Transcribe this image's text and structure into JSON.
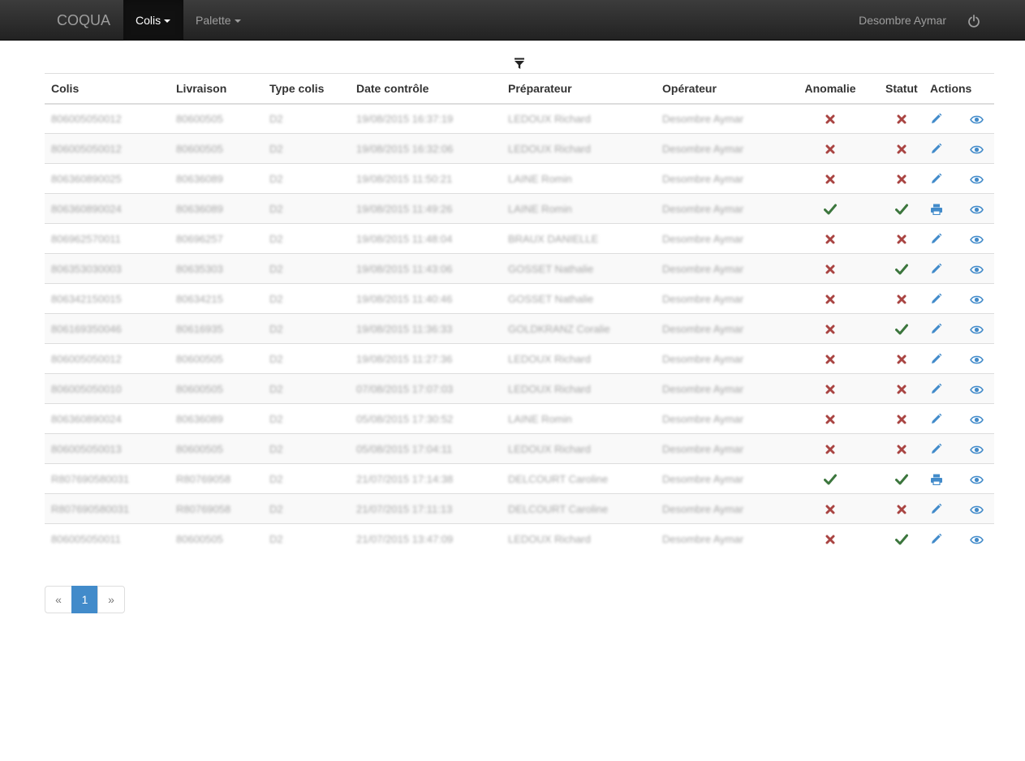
{
  "navbar": {
    "brand": "COQUA",
    "menu_colis": "Colis",
    "menu_palette": "Palette",
    "user": "Desombre Aymar",
    "power_icon": "power-icon"
  },
  "filter_icon": "filter-icon",
  "table": {
    "headers": [
      "Colis",
      "Livraison",
      "Type colis",
      "Date contrôle",
      "Préparateur",
      "Opérateur",
      "Anomalie",
      "Statut",
      "Actions"
    ],
    "rows": [
      {
        "colis": "806005050012",
        "livraison": "80600505",
        "type": "D2",
        "date": "19/08/2015 16:37:19",
        "preparateur": "LEDOUX Richard",
        "operateur": "Desombre Aymar",
        "anomalie": false,
        "statut": false,
        "action": "edit"
      },
      {
        "colis": "806005050012",
        "livraison": "80600505",
        "type": "D2",
        "date": "19/08/2015 16:32:06",
        "preparateur": "LEDOUX Richard",
        "operateur": "Desombre Aymar",
        "anomalie": false,
        "statut": false,
        "action": "edit"
      },
      {
        "colis": "806360890025",
        "livraison": "80636089",
        "type": "D2",
        "date": "19/08/2015 11:50:21",
        "preparateur": "LAINE Romin",
        "operateur": "Desombre Aymar",
        "anomalie": false,
        "statut": false,
        "action": "edit"
      },
      {
        "colis": "806360890024",
        "livraison": "80636089",
        "type": "D2",
        "date": "19/08/2015 11:49:26",
        "preparateur": "LAINE Romin",
        "operateur": "Desombre Aymar",
        "anomalie": true,
        "statut": true,
        "action": "print"
      },
      {
        "colis": "806962570011",
        "livraison": "80696257",
        "type": "D2",
        "date": "19/08/2015 11:48:04",
        "preparateur": "BRAUX DANIELLE",
        "operateur": "Desombre Aymar",
        "anomalie": false,
        "statut": false,
        "action": "edit"
      },
      {
        "colis": "806353030003",
        "livraison": "80635303",
        "type": "D2",
        "date": "19/08/2015 11:43:06",
        "preparateur": "GOSSET Nathalie",
        "operateur": "Desombre Aymar",
        "anomalie": false,
        "statut": true,
        "action": "edit"
      },
      {
        "colis": "806342150015",
        "livraison": "80634215",
        "type": "D2",
        "date": "19/08/2015 11:40:46",
        "preparateur": "GOSSET Nathalie",
        "operateur": "Desombre Aymar",
        "anomalie": false,
        "statut": false,
        "action": "edit"
      },
      {
        "colis": "806169350046",
        "livraison": "80616935",
        "type": "D2",
        "date": "19/08/2015 11:36:33",
        "preparateur": "GOLDKRANZ Coralie",
        "operateur": "Desombre Aymar",
        "anomalie": false,
        "statut": true,
        "action": "edit"
      },
      {
        "colis": "806005050012",
        "livraison": "80600505",
        "type": "D2",
        "date": "19/08/2015 11:27:36",
        "preparateur": "LEDOUX Richard",
        "operateur": "Desombre Aymar",
        "anomalie": false,
        "statut": false,
        "action": "edit"
      },
      {
        "colis": "806005050010",
        "livraison": "80600505",
        "type": "D2",
        "date": "07/08/2015 17:07:03",
        "preparateur": "LEDOUX Richard",
        "operateur": "Desombre Aymar",
        "anomalie": false,
        "statut": false,
        "action": "edit"
      },
      {
        "colis": "806360890024",
        "livraison": "80636089",
        "type": "D2",
        "date": "05/08/2015 17:30:52",
        "preparateur": "LAINE Romin",
        "operateur": "Desombre Aymar",
        "anomalie": false,
        "statut": false,
        "action": "edit"
      },
      {
        "colis": "806005050013",
        "livraison": "80600505",
        "type": "D2",
        "date": "05/08/2015 17:04:11",
        "preparateur": "LEDOUX Richard",
        "operateur": "Desombre Aymar",
        "anomalie": false,
        "statut": false,
        "action": "edit"
      },
      {
        "colis": "R807690580031",
        "livraison": "R80769058",
        "type": "D2",
        "date": "21/07/2015 17:14:38",
        "preparateur": "DELCOURT Caroline",
        "operateur": "Desombre Aymar",
        "anomalie": true,
        "statut": true,
        "action": "print"
      },
      {
        "colis": "R807690580031",
        "livraison": "R80769058",
        "type": "D2",
        "date": "21/07/2015 17:11:13",
        "preparateur": "DELCOURT Caroline",
        "operateur": "Desombre Aymar",
        "anomalie": false,
        "statut": false,
        "action": "edit"
      },
      {
        "colis": "806005050011",
        "livraison": "80600505",
        "type": "D2",
        "date": "21/07/2015 13:47:09",
        "preparateur": "LEDOUX Richard",
        "operateur": "Desombre Aymar",
        "anomalie": false,
        "statut": true,
        "action": "edit"
      }
    ]
  },
  "pagination": {
    "prev": "«",
    "current": "1",
    "next": "»"
  },
  "colors": {
    "ok": "#3c763d",
    "ko": "#a94442",
    "action": "#428bca"
  }
}
